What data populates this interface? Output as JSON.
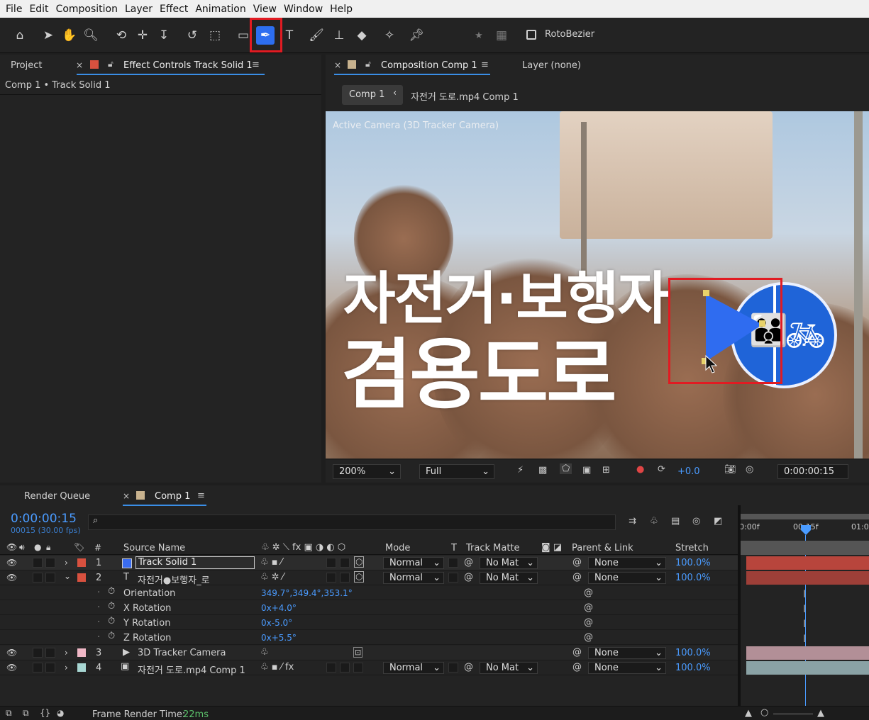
{
  "menu": {
    "items": [
      "File",
      "Edit",
      "Composition",
      "Layer",
      "Effect",
      "Animation",
      "View",
      "Window",
      "Help"
    ]
  },
  "toolbar": {
    "roto_label": "RotoBezier"
  },
  "left_panel": {
    "tab_project": "Project",
    "tab_effect": "Effect Controls Track Solid 1",
    "breadcrumb": "Comp 1 • Track Solid 1"
  },
  "comp_panel": {
    "tab_label": "Composition Comp 1",
    "layer_tab": "Layer (none)",
    "crumb_comp": "Comp 1",
    "crumb_sub": "자전거 도로.mp4 Comp 1",
    "camera_label": "Active Camera (3D Tracker Camera)"
  },
  "video_text": {
    "line1": "자전거·보행자",
    "line2": "겸용도로"
  },
  "viewer_footer": {
    "zoom": "200%",
    "resolution": "Full",
    "exposure": "+0.0",
    "timecode": "0:00:00:15"
  },
  "timeline": {
    "tab_render": "Render Queue",
    "tab_comp": "Comp 1",
    "timecode": "0:00:00:15",
    "frames": "00015 (30.00 fps)",
    "headers": {
      "source": "Source Name",
      "mode": "Mode",
      "t": "T",
      "matte": "Track Matte",
      "parent": "Parent & Link",
      "stretch": "Stretch"
    },
    "ruler": {
      "start": "0:00f",
      "mid": "00:15f",
      "end": "01:0"
    },
    "layers": [
      {
        "num": "1",
        "name": "Track Solid 1",
        "mode": "Normal",
        "matte": "No Mat",
        "parent": "None",
        "stretch": "100.0%",
        "color": "#d8513f",
        "bar": "#b8453c"
      },
      {
        "num": "2",
        "name": "자전거●보행자_로",
        "mode": "Normal",
        "matte": "No Mat",
        "parent": "None",
        "stretch": "100.0%",
        "color": "#d8513f",
        "bar": "#9e3f38"
      },
      {
        "num": "3",
        "name": "3D Tracker Camera",
        "parent": "None",
        "stretch": "100.0%",
        "color": "#f0b7c6",
        "bar": "#b28f97"
      },
      {
        "num": "4",
        "name": "자전거 도로.mp4 Comp 1",
        "mode": "Normal",
        "matte": "No Mat",
        "parent": "None",
        "stretch": "100.0%",
        "color": "#a7d6d2",
        "bar": "#8aa2a5"
      }
    ],
    "props": [
      {
        "name": "Orientation",
        "value": "349.7°,349.4°,353.1°"
      },
      {
        "name": "X Rotation",
        "value": "0x+4.0°"
      },
      {
        "name": "Y Rotation",
        "value": "0x-5.0°"
      },
      {
        "name": "Z Rotation",
        "value": "0x+5.5°"
      }
    ],
    "frame_render_label": "Frame Render Time:",
    "frame_render_value": "22ms"
  },
  "colors": {
    "accent": "#2d6ef0",
    "highlight": "#e11b22",
    "link_blue": "#4a9bff"
  }
}
